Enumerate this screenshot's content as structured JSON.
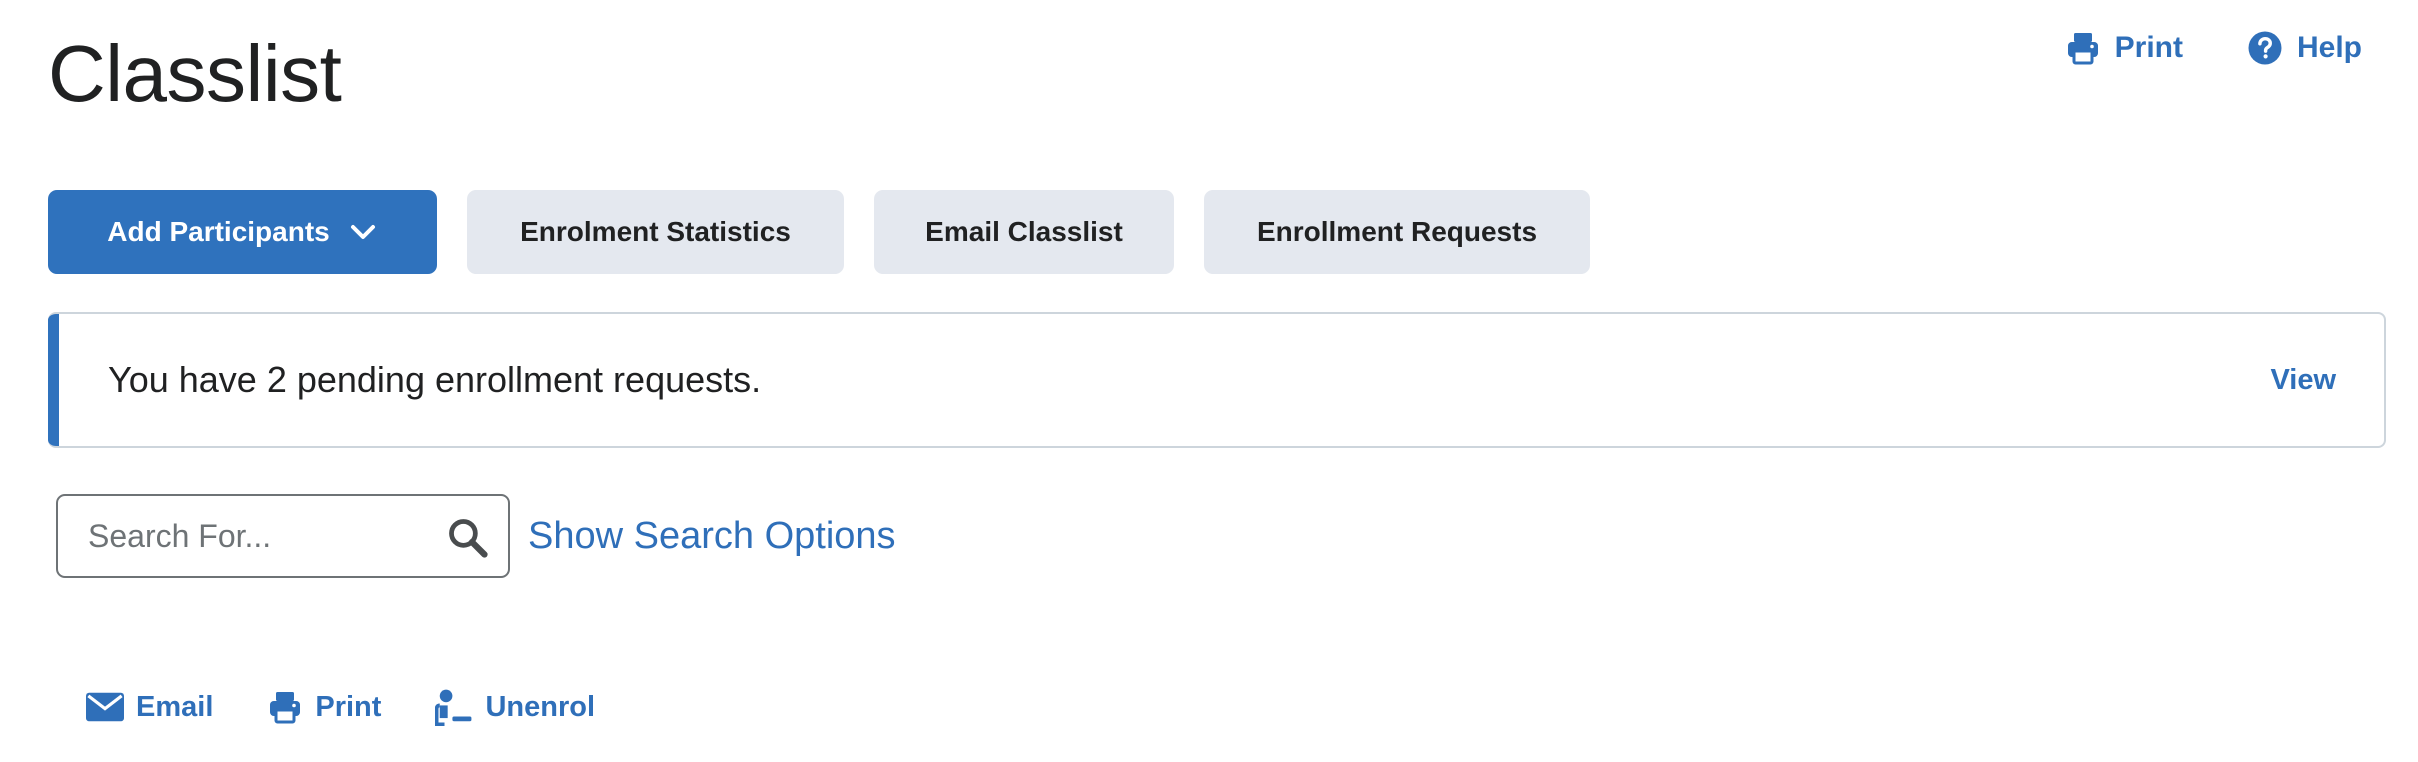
{
  "page": {
    "title": "Classlist"
  },
  "top_actions": {
    "print_label": "Print",
    "help_label": "Help",
    "print_icon": "printer-icon",
    "help_icon": "help-circle-icon"
  },
  "buttons": {
    "add_participants": "Add Participants",
    "enrolment_statistics": "Enrolment Statistics",
    "email_classlist": "Email Classlist",
    "enrollment_requests": "Enrollment Requests"
  },
  "alert": {
    "message": "You have 2 pending enrollment requests.",
    "action": "View"
  },
  "search": {
    "placeholder": "Search For...",
    "value": "",
    "options_link": "Show Search Options"
  },
  "bulk_actions": {
    "email": "Email",
    "print": "Print",
    "unenrol": "Unenrol"
  },
  "colors": {
    "accent": "#2f72bd",
    "link": "#2f6fb9",
    "secondary_button_bg": "#e4e8ef",
    "text": "#202122",
    "border": "#cdd5dc"
  }
}
